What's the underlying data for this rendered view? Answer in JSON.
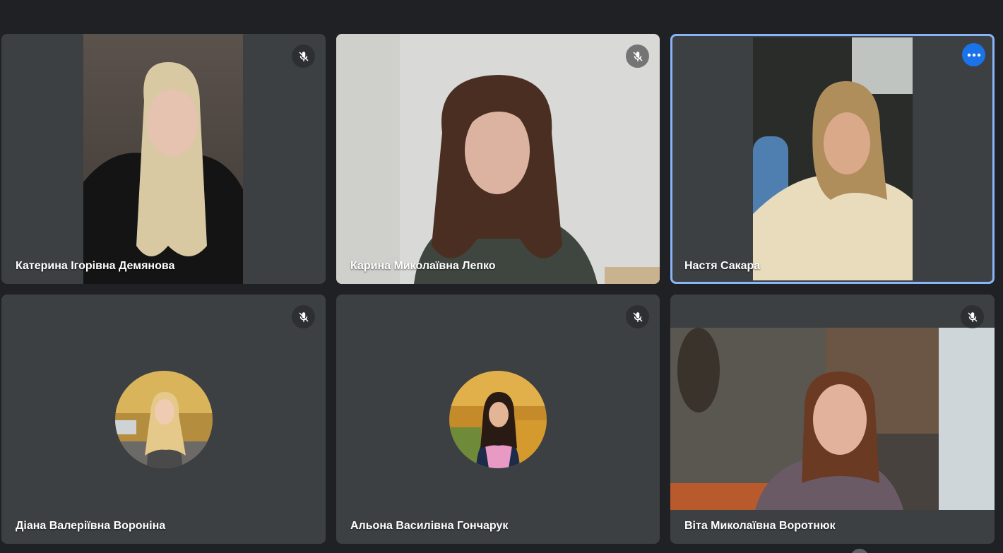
{
  "meeting": {
    "participants": [
      {
        "name": "Катерина Ігорівна Демянова",
        "muted": true,
        "mode": "video"
      },
      {
        "name": "Карина Миколаївна Лепко",
        "muted": true,
        "mode": "video"
      },
      {
        "name": "Настя Сакара",
        "muted": false,
        "mode": "video",
        "active": true
      },
      {
        "name": "Діана Валеріївна Вороніна",
        "muted": true,
        "mode": "avatar"
      },
      {
        "name": "Альона Василівна Гончарук",
        "muted": true,
        "mode": "avatar"
      },
      {
        "name": "Віта Миколаївна Воротнюк",
        "muted": true,
        "mode": "video"
      }
    ]
  },
  "icons": {
    "mic_off": "mic-off-icon",
    "more_options": "more-options-icon"
  },
  "colors": {
    "background": "#202124",
    "tile": "#3c4043",
    "active_border": "#8ab4f8",
    "accent": "#1a73e8"
  }
}
